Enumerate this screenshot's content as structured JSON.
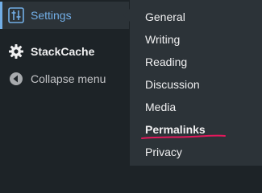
{
  "sidebar": {
    "current": {
      "label": "Settings",
      "icon": "settings-sliders-icon"
    },
    "items": [
      {
        "label": "StackCache",
        "icon": "gear-icon"
      },
      {
        "label": "Collapse menu",
        "icon": "collapse-arrow-icon"
      }
    ]
  },
  "submenu": {
    "items": [
      {
        "label": "General"
      },
      {
        "label": "Writing"
      },
      {
        "label": "Reading"
      },
      {
        "label": "Discussion"
      },
      {
        "label": "Media"
      },
      {
        "label": "Permalinks",
        "annotation": "underlined"
      },
      {
        "label": "Privacy"
      }
    ]
  },
  "colors": {
    "sidebar_bg": "#1d2327",
    "submenu_bg": "#2c3338",
    "accent": "#72aee6",
    "text": "#f0f0f1",
    "muted_text": "#c3c4c7",
    "annotation": "#e2185b"
  }
}
